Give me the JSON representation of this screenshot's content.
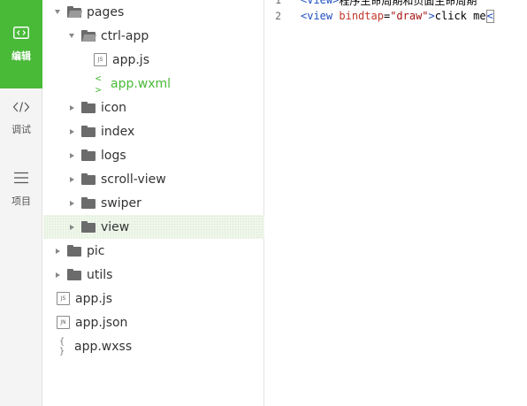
{
  "activity_bar": {
    "items": [
      {
        "id": "edit",
        "icon": "code-icon",
        "label": "编辑",
        "active": true
      },
      {
        "id": "debug",
        "icon": "debug-icon",
        "label": "调试",
        "active": false
      },
      {
        "id": "project",
        "icon": "menu-icon",
        "label": "项目",
        "active": false
      }
    ],
    "accent_color": "#49b938"
  },
  "file_tree": {
    "items": [
      {
        "type": "folder",
        "name": "pages",
        "expanded": true
      },
      {
        "type": "folder",
        "name": "ctrl-app",
        "expanded": true
      },
      {
        "type": "file",
        "name": "app.js",
        "icon": "js-file-icon",
        "badge": "JS"
      },
      {
        "type": "file",
        "name": "app.wxml",
        "icon": "code-file-icon",
        "active": true,
        "badge": "< >"
      },
      {
        "type": "folder",
        "name": "icon",
        "expanded": false
      },
      {
        "type": "folder",
        "name": "index",
        "expanded": false
      },
      {
        "type": "folder",
        "name": "logs",
        "expanded": false
      },
      {
        "type": "folder",
        "name": "scroll-view",
        "expanded": false
      },
      {
        "type": "folder",
        "name": "swiper",
        "expanded": false
      },
      {
        "type": "folder",
        "name": "view",
        "expanded": false,
        "selected": true
      },
      {
        "type": "folder",
        "name": "pic",
        "expanded": false
      },
      {
        "type": "folder",
        "name": "utils",
        "expanded": false
      },
      {
        "type": "file",
        "name": "app.js",
        "icon": "js-file-icon",
        "badge": "JS"
      },
      {
        "type": "file",
        "name": "app.json",
        "icon": "json-file-icon",
        "badge": "JN"
      },
      {
        "type": "file",
        "name": "app.wxss",
        "icon": "css-file-icon",
        "badge": "{ }"
      }
    ]
  },
  "editor": {
    "lines": [
      {
        "number": "1",
        "open_bracket": "<",
        "tag": "view",
        "close_bracket": ">",
        "text": "程序生命周期和页面生命周期"
      },
      {
        "number": "2",
        "open_bracket": "<",
        "tag": "view",
        "attr": "bindtap",
        "eq": "=",
        "value": "\"draw\"",
        "close_bracket": ">",
        "text": "click me",
        "cursor": "<"
      }
    ]
  }
}
